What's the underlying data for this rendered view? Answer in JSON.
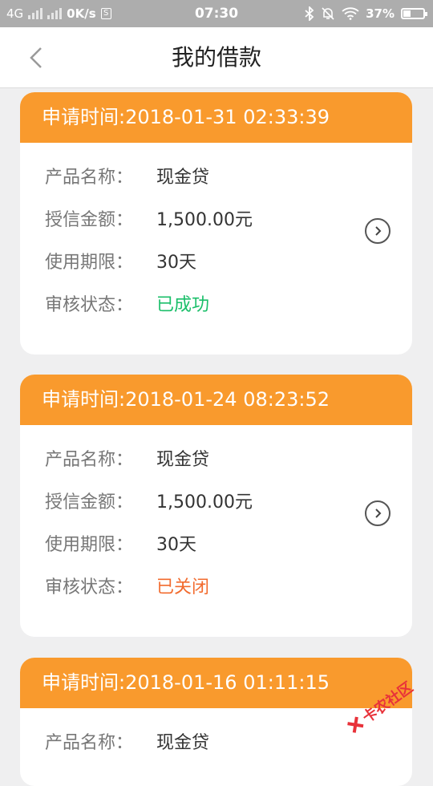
{
  "status_bar": {
    "network": "4G",
    "speed": "0K/s",
    "time": "07:30",
    "battery": "37%",
    "battery_level": 0.37
  },
  "header": {
    "title": "我的借款"
  },
  "labels": {
    "product": "产品名称：",
    "amount": "授信金额：",
    "term": "使用期限：",
    "status": "审核状态："
  },
  "loans": [
    {
      "apply_time": "申请时间:2018-01-31 02:33:39",
      "product": "现金贷",
      "amount": "1,500.00元",
      "term": "30天",
      "status": "已成功"
    },
    {
      "apply_time": "申请时间:2018-01-24 08:23:52",
      "product": "现金贷",
      "amount": "1,500.00元",
      "term": "30天",
      "status": "已关闭"
    },
    {
      "apply_time": "申请时间:2018-01-16 01:11:15",
      "product": "现金贷"
    }
  ],
  "colors": {
    "accent": "#f99a2d",
    "success": "#1bbf6a",
    "closed": "#f26b2e",
    "watermark": "#e8323a"
  },
  "watermark": "卡农社区"
}
